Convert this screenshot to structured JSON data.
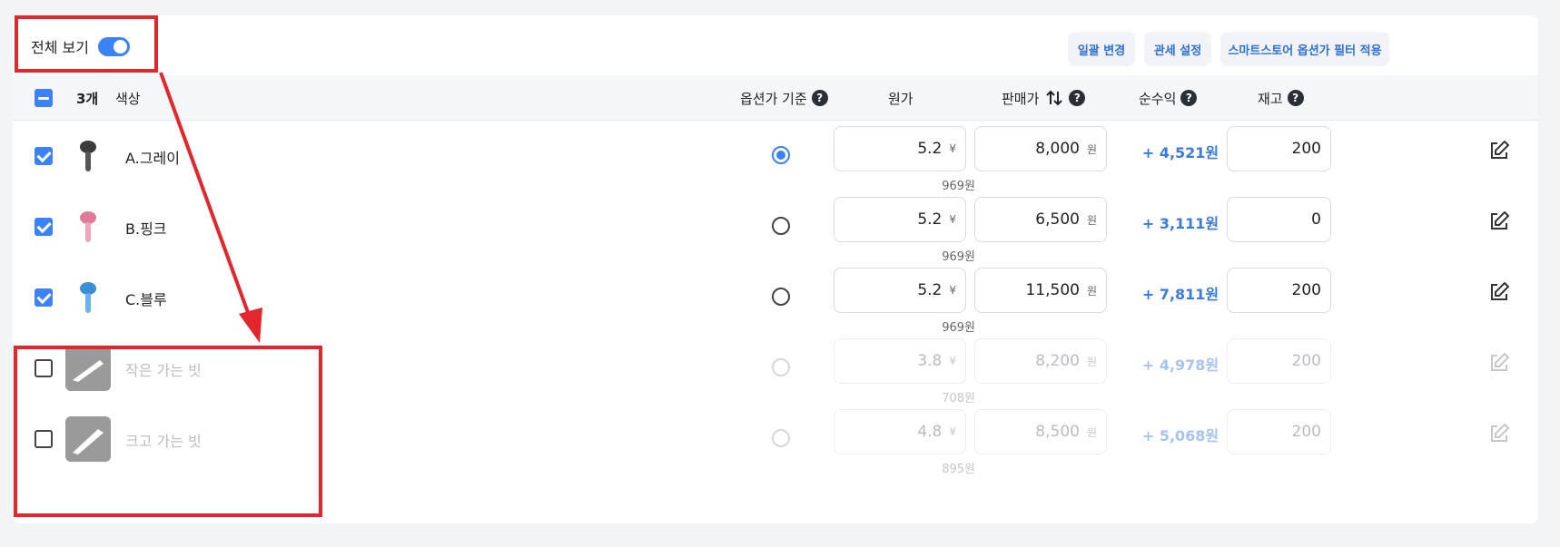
{
  "topbar": {
    "toggle_label": "전체 보기",
    "buttons": [
      "일괄 변경",
      "관세 설정",
      "스마트스토어 옵션가 필터 적용"
    ]
  },
  "header": {
    "count": "3개",
    "color_col": "색상",
    "base_col": "옵션가 기준",
    "cost_col": "원가",
    "price_col": "판매가",
    "profit_col": "순수익",
    "stock_col": "재고"
  },
  "rows": [
    {
      "name": "A.그레이",
      "cost": "5.2",
      "cost_unit": "¥",
      "cost_krw": "969원",
      "price": "8,000",
      "price_unit": "원",
      "profit": "+ 4,521원",
      "stock": "200"
    },
    {
      "name": "B.핑크",
      "cost": "5.2",
      "cost_unit": "¥",
      "cost_krw": "969원",
      "price": "6,500",
      "price_unit": "원",
      "profit": "+ 3,111원",
      "stock": "0"
    },
    {
      "name": "C.블루",
      "cost": "5.2",
      "cost_unit": "¥",
      "cost_krw": "969원",
      "price": "11,500",
      "price_unit": "원",
      "profit": "+ 7,811원",
      "stock": "200"
    },
    {
      "name": "작은 가는 빗",
      "cost": "3.8",
      "cost_unit": "¥",
      "cost_krw": "708원",
      "price": "8,200",
      "price_unit": "원",
      "profit": "+ 4,978원",
      "stock": "200"
    },
    {
      "name": "크고 가는 빗",
      "cost": "4.8",
      "cost_unit": "¥",
      "cost_krw": "895원",
      "price": "8,500",
      "price_unit": "원",
      "profit": "+ 5,068원",
      "stock": "200"
    }
  ],
  "accent_color": "#3b82f6",
  "annotation_color": "#e2262b"
}
